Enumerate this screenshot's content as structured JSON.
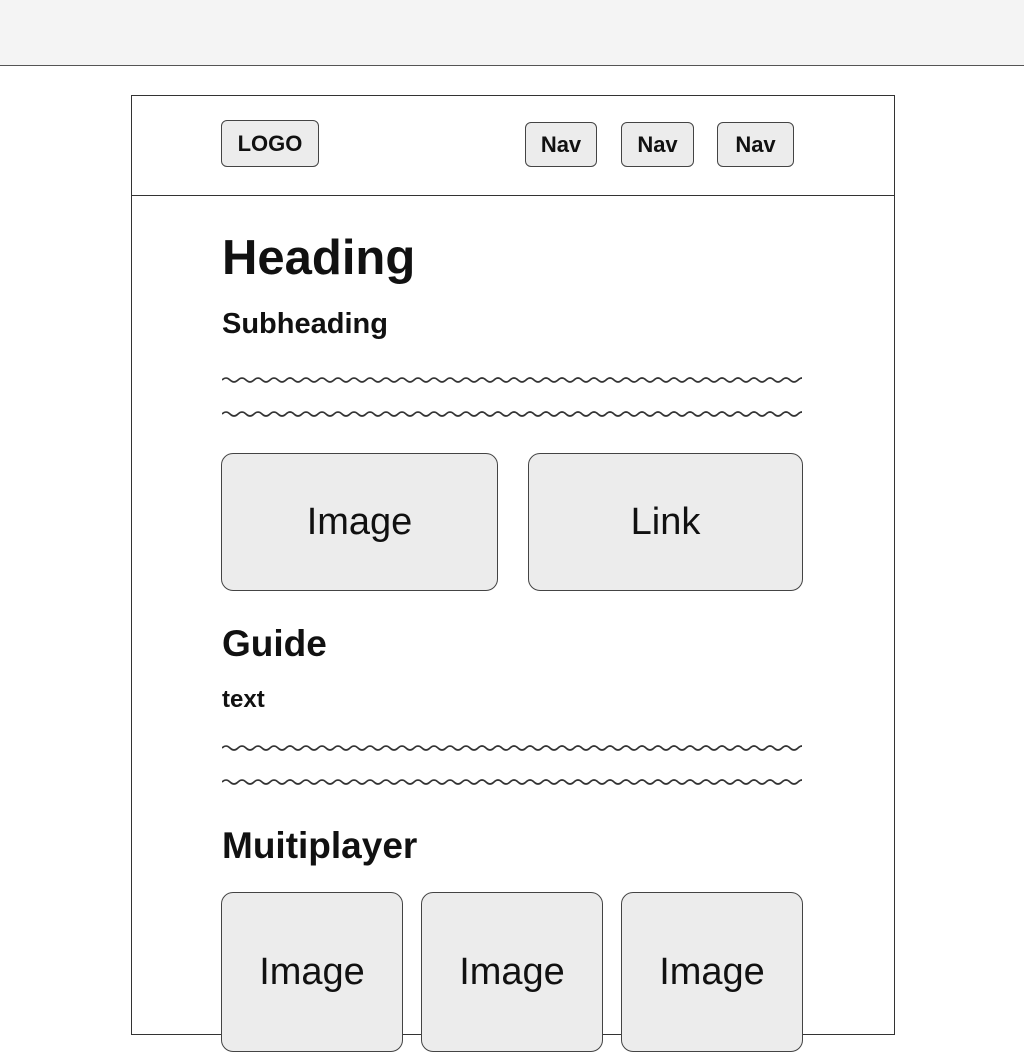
{
  "header": {
    "logo_label": "LOGO",
    "nav": [
      "Nav",
      "Nav",
      "Nav"
    ]
  },
  "main": {
    "heading": "Heading",
    "subheading": "Subheading",
    "tiles": {
      "image_label": "Image",
      "link_label": "Link"
    },
    "guide": {
      "title": "Guide",
      "text_label": "text"
    },
    "multiplayer": {
      "title": "Muitiplayer",
      "images": [
        "Image",
        "Image",
        "Image"
      ]
    }
  },
  "colors": {
    "border": "#333333",
    "placeholder_fill": "#ececec",
    "topbar": "#f4f4f4"
  }
}
